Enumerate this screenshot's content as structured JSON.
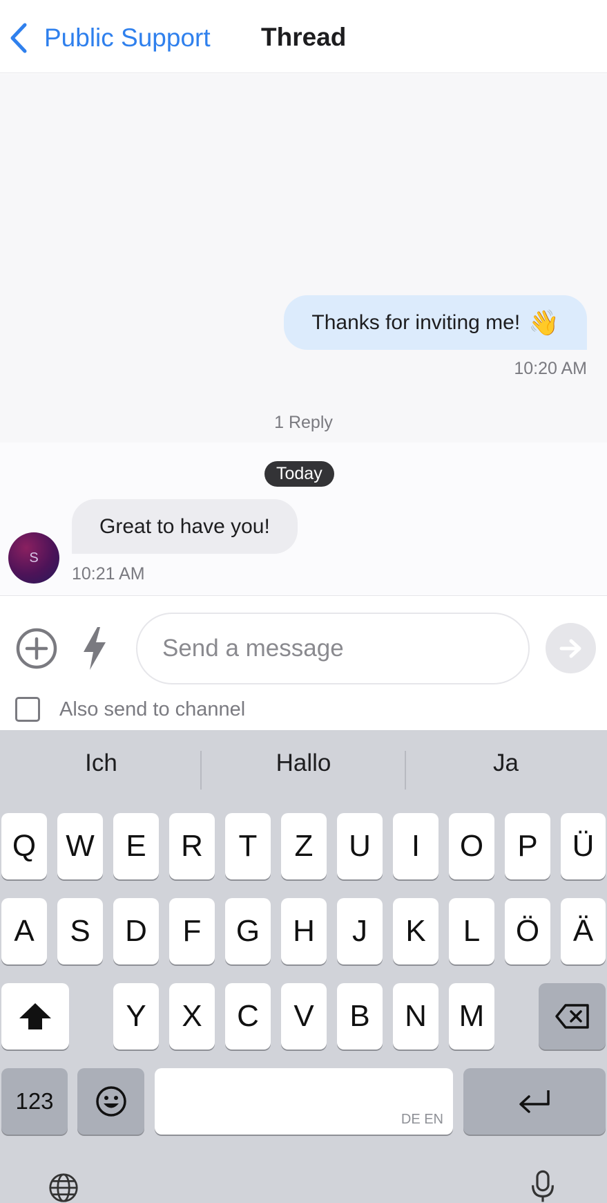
{
  "header": {
    "back_label": "Public Support",
    "title": "Thread"
  },
  "parent_message": {
    "text": "Thanks for inviting me!",
    "emoji": "👋",
    "time": "10:20 AM",
    "reply_count": "1 Reply"
  },
  "thread": {
    "date_separator": "Today",
    "reply": {
      "text": "Great to have you!",
      "time": "10:21 AM",
      "avatar_initial": "S"
    }
  },
  "composer": {
    "placeholder": "Send a message",
    "also_send_label": "Also send to channel",
    "also_send_checked": false
  },
  "keyboard": {
    "suggestions": [
      "Ich",
      "Hallo",
      "Ja"
    ],
    "row1": [
      "Q",
      "W",
      "E",
      "R",
      "T",
      "Z",
      "U",
      "I",
      "O",
      "P",
      "Ü"
    ],
    "row2": [
      "A",
      "S",
      "D",
      "F",
      "G",
      "H",
      "J",
      "K",
      "L",
      "Ö",
      "Ä"
    ],
    "row3": [
      "Y",
      "X",
      "C",
      "V",
      "B",
      "N",
      "M"
    ],
    "numbers_label": "123",
    "space_languages": "DE EN"
  },
  "icons": [
    "chevron-left-icon",
    "plus-circle-icon",
    "bolt-icon",
    "arrow-right-icon",
    "shift-icon",
    "backspace-icon",
    "emoji-icon",
    "return-icon",
    "globe-icon",
    "microphone-icon"
  ],
  "colors": {
    "accent": "#2f80ed",
    "outgoing_bubble": "#dcebfc",
    "incoming_bubble": "#ececf0",
    "keyboard_bg": "#d1d3d9"
  }
}
